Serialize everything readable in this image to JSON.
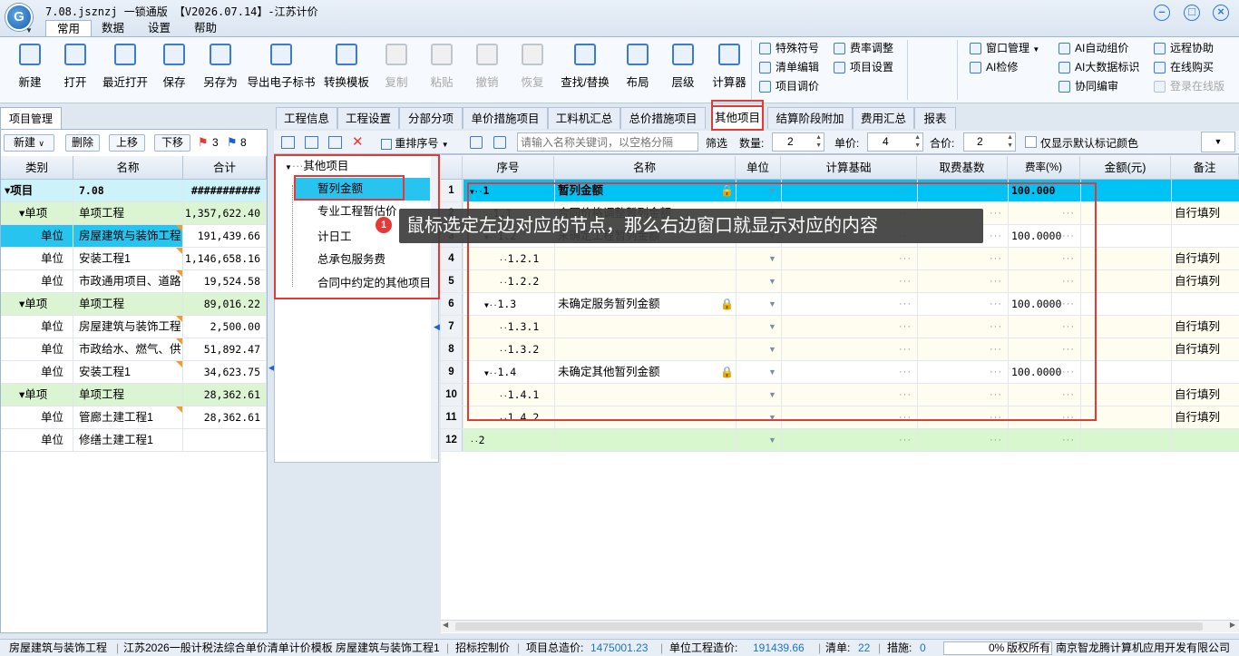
{
  "window": {
    "title": "7.08.jsznzj 一锁通版 【V2026.07.14】-江苏计价",
    "logo_text": "G",
    "menus": [
      "常用",
      "数据",
      "设置",
      "帮助"
    ]
  },
  "ribbon": {
    "big_buttons": [
      {
        "label": "新建",
        "enabled": true
      },
      {
        "label": "打开",
        "enabled": true
      },
      {
        "label": "最近打开",
        "enabled": true
      },
      {
        "label": "保存",
        "enabled": true
      },
      {
        "label": "另存为",
        "enabled": true
      },
      {
        "label": "导出电子标书",
        "enabled": true
      },
      {
        "label": "转换模板",
        "enabled": true
      },
      {
        "label": "复制",
        "enabled": false
      },
      {
        "label": "粘贴",
        "enabled": false
      },
      {
        "label": "撤销",
        "enabled": false
      },
      {
        "label": "恢复",
        "enabled": false
      },
      {
        "label": "查找/替换",
        "enabled": true
      },
      {
        "label": "布局",
        "enabled": true
      },
      {
        "label": "层级",
        "enabled": true
      },
      {
        "label": "计算器",
        "enabled": true
      }
    ],
    "small_col1": [
      "特殊符号",
      "清单编辑",
      "项目调价"
    ],
    "small_col2": [
      "费率调整",
      "项目设置"
    ],
    "right_col1": [
      "窗口管理",
      "AI检修"
    ],
    "right_col2": [
      "AI自动组价",
      "AI大数据标识",
      "协同编审"
    ],
    "right_col3": [
      "远程协助",
      "在线购买",
      "登录在线版"
    ]
  },
  "tabs": [
    "工程信息",
    "工程设置",
    "分部分项",
    "单价措施项目",
    "工料机汇总",
    "总价措施项目",
    "其他项目",
    "结算阶段附加",
    "费用汇总",
    "报表"
  ],
  "left_panel": {
    "title": "项目管理",
    "toolbar": {
      "new": "新建",
      "delete": "删除",
      "up": "上移",
      "down": "下移",
      "red_flag_count": "3",
      "blue_flag_count": "8"
    },
    "columns": [
      "类别",
      "名称",
      "合计"
    ],
    "rows": [
      {
        "type": "项目",
        "name": "7.08",
        "total": "###########"
      },
      {
        "type": "单项",
        "name": "单项工程",
        "total": "1,357,622.40"
      },
      {
        "type": "单位",
        "name": "房屋建筑与装饰工程",
        "total": "191,439.66"
      },
      {
        "type": "单位",
        "name": "安装工程1",
        "total": "1,146,658.16"
      },
      {
        "type": "单位",
        "name": "市政通用项目、道路",
        "total": "19,524.58"
      },
      {
        "type": "单项",
        "name": "单项工程",
        "total": "89,016.22"
      },
      {
        "type": "单位",
        "name": "房屋建筑与装饰工程",
        "total": "2,500.00"
      },
      {
        "type": "单位",
        "name": "市政给水、燃气、供",
        "total": "51,892.47"
      },
      {
        "type": "单位",
        "name": "安装工程1",
        "total": "34,623.75"
      },
      {
        "type": "单项",
        "name": "单项工程",
        "total": "28,362.61"
      },
      {
        "type": "单位",
        "name": "管廊土建工程1",
        "total": "28,362.61"
      },
      {
        "type": "单位",
        "name": "修缮土建工程1",
        "total": ""
      }
    ]
  },
  "sub_toolbar": {
    "reorder": "重排序号",
    "search_placeholder": "请输入名称关键词，以空格分隔",
    "filter": "筛选",
    "qty_label": "数量:",
    "qty_value": "2",
    "price_label": "单价:",
    "price_value": "4",
    "total_label": "合价:",
    "total_value": "2",
    "checkbox_label": "仅显示默认标记颜色"
  },
  "tree": {
    "root": "其他项目",
    "items": [
      "暂列金额",
      "专业工程暂估价",
      "计日工",
      "总承包服务费",
      "合同中约定的其他项目"
    ]
  },
  "grid": {
    "columns": [
      "序号",
      "名称",
      "单位",
      "计算基础",
      "取费基数",
      "费率(%)",
      "金额(元)",
      "备注"
    ],
    "rows": [
      {
        "n": "1",
        "seq": "1",
        "name": "暂列金额",
        "rate": "100.000",
        "note": ""
      },
      {
        "n": "2",
        "seq": "1.1",
        "name": "合同价格调整暂列金额",
        "rate": "",
        "note": "自行填列"
      },
      {
        "n": "3",
        "seq": "1.2",
        "name": "未确定工程暂列金额",
        "rate": "100.0000",
        "note": ""
      },
      {
        "n": "4",
        "seq": "1.2.1",
        "name": "",
        "rate": "",
        "note": "自行填列"
      },
      {
        "n": "5",
        "seq": "1.2.2",
        "name": "",
        "rate": "",
        "note": "自行填列"
      },
      {
        "n": "6",
        "seq": "1.3",
        "name": "未确定服务暂列金额",
        "rate": "100.0000",
        "note": ""
      },
      {
        "n": "7",
        "seq": "1.3.1",
        "name": "",
        "rate": "",
        "note": "自行填列"
      },
      {
        "n": "8",
        "seq": "1.3.2",
        "name": "",
        "rate": "",
        "note": "自行填列"
      },
      {
        "n": "9",
        "seq": "1.4",
        "name": "未确定其他暂列金额",
        "rate": "100.0000",
        "note": ""
      },
      {
        "n": "10",
        "seq": "1.4.1",
        "name": "",
        "rate": "",
        "note": "自行填列"
      },
      {
        "n": "11",
        "seq": "1.4.2",
        "name": "",
        "rate": "",
        "note": "自行填列"
      },
      {
        "n": "12",
        "seq": "2",
        "name": "",
        "rate": "",
        "note": ""
      }
    ]
  },
  "tooltip": {
    "badge": "1",
    "text": "鼠标选定左边对应的节点，那么右边窗口就显示对应的内容"
  },
  "status": {
    "project": "房屋建筑与装饰工程",
    "template": "江苏2026一般计税法综合单价清单计价模板",
    "unit": "房屋建筑与装饰工程1",
    "bid": "招标控制价",
    "total_label": "项目总造价:",
    "total_value": "1475001.23",
    "unit_label": "单位工程造价:",
    "unit_value": "191439.66",
    "list_label": "清单:",
    "list_value": "22",
    "measure_label": "措施:",
    "measure_value": "0",
    "progress": "0%",
    "copyright": "版权所有",
    "company": "南京智龙腾计算机应用开发有限公司"
  }
}
